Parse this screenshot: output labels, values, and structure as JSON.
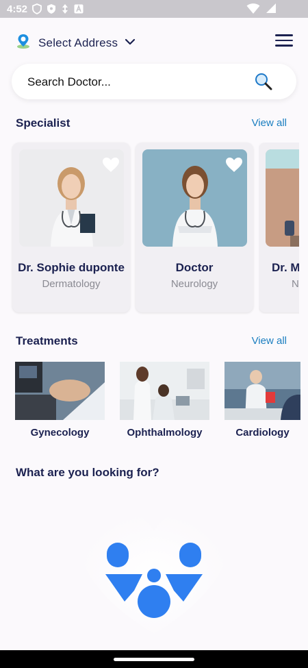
{
  "status": {
    "time": "4:52"
  },
  "header": {
    "address_label": "Select Address"
  },
  "search": {
    "placeholder": "Search Doctor..."
  },
  "specialist": {
    "title": "Specialist",
    "view_all": "View all",
    "cards": [
      {
        "name": "Dr. Sophie duponte",
        "dept": "Dermatology"
      },
      {
        "name": "Doctor",
        "dept": "Neurology"
      },
      {
        "name": "Dr. M",
        "dept": "N"
      }
    ]
  },
  "treatments": {
    "title": "Treatments",
    "view_all": "View all",
    "items": [
      {
        "label": "Gynecolog​y"
      },
      {
        "label": "Ophthalm​ology"
      },
      {
        "label": "Cardiolog​y"
      }
    ]
  },
  "looking_for": {
    "title": "What are you looking for?"
  },
  "colors": {
    "brand_blue": "#2f7ff0",
    "accent_link": "#1a7ec0",
    "text_dark": "#1b2150"
  }
}
